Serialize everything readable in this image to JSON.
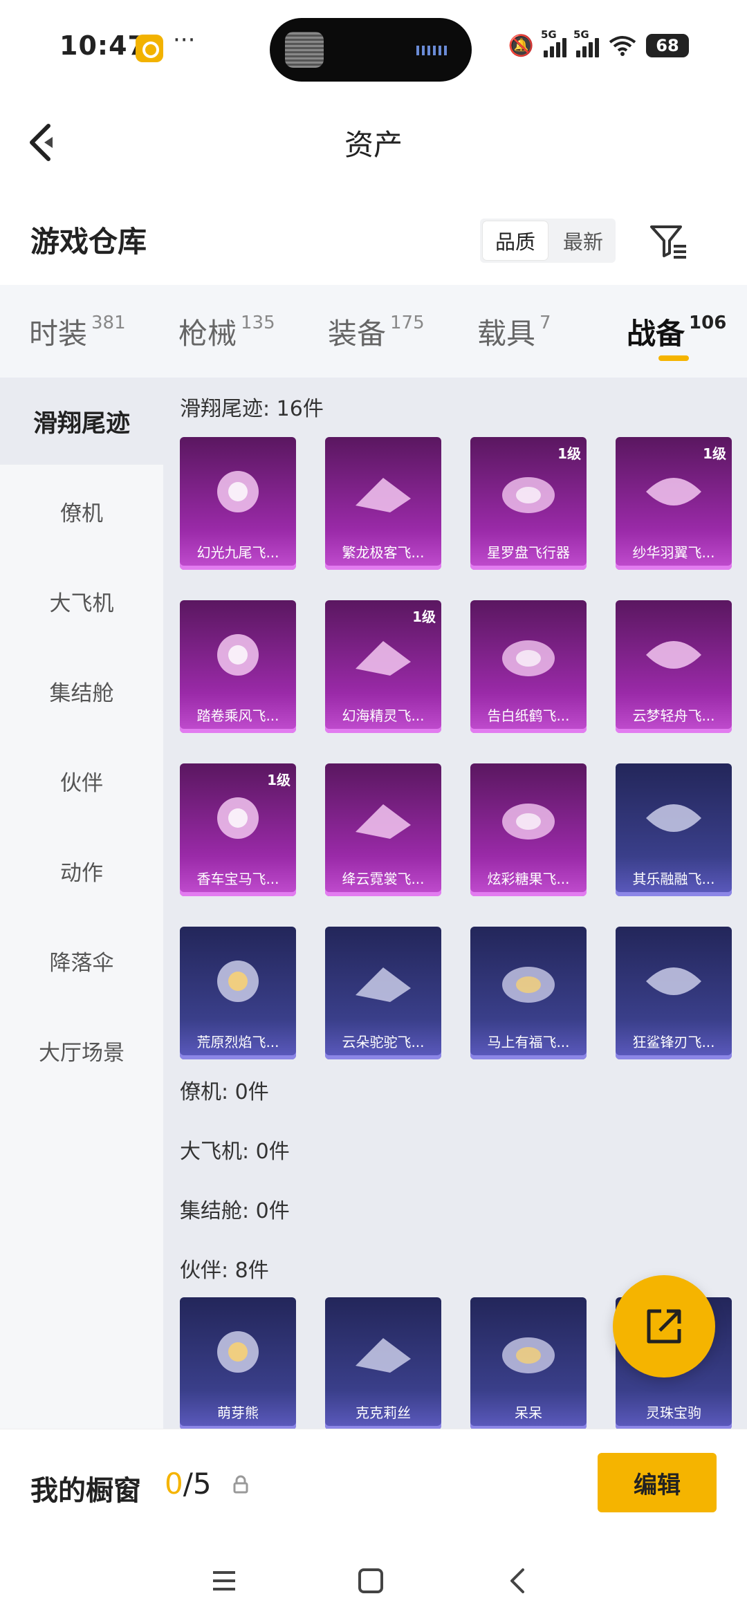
{
  "status_bar": {
    "time": "10:47",
    "more": "···",
    "sig1_label": "5G",
    "sig2_label": "5G",
    "battery": "68"
  },
  "header": {
    "title": "资产"
  },
  "warehouse": {
    "title": "游戏仓库",
    "sort_options": [
      "品质",
      "最新"
    ]
  },
  "tabs": [
    {
      "label": "时装",
      "count": "381"
    },
    {
      "label": "枪械",
      "count": "135"
    },
    {
      "label": "装备",
      "count": "175"
    },
    {
      "label": "载具",
      "count": "7"
    },
    {
      "label": "战备",
      "count": "106"
    }
  ],
  "sidebar": {
    "items": [
      "滑翔尾迹",
      "僚机",
      "大飞机",
      "集结舱",
      "伙伴",
      "动作",
      "降落伞",
      "大厅场景"
    ]
  },
  "sections": {
    "glide": {
      "title": "滑翔尾迹: 16件"
    },
    "wingman": {
      "title": "僚机: 0件"
    },
    "bigplane": {
      "title": "大飞机: 0件"
    },
    "capsule": {
      "title": "集结舱: 0件"
    },
    "partner": {
      "title": "伙伴: 8件"
    }
  },
  "glide_items": [
    {
      "name": "幻光九尾飞...",
      "level": "",
      "rarity": "purple"
    },
    {
      "name": "繁龙极客飞...",
      "level": "",
      "rarity": "purple"
    },
    {
      "name": "星罗盘飞行器",
      "level": "1级",
      "rarity": "purple"
    },
    {
      "name": "纱华羽翼飞...",
      "level": "1级",
      "rarity": "purple"
    },
    {
      "name": "踏卷乘风飞...",
      "level": "",
      "rarity": "purple"
    },
    {
      "name": "幻海精灵飞...",
      "level": "1级",
      "rarity": "purple"
    },
    {
      "name": "告白纸鹤飞...",
      "level": "",
      "rarity": "purple"
    },
    {
      "name": "云梦轻舟飞...",
      "level": "",
      "rarity": "purple"
    },
    {
      "name": "香车宝马飞...",
      "level": "1级",
      "rarity": "purple"
    },
    {
      "name": "绛云霓裳飞...",
      "level": "",
      "rarity": "purple"
    },
    {
      "name": "炫彩糖果飞...",
      "level": "",
      "rarity": "purple"
    },
    {
      "name": "其乐融融飞...",
      "level": "",
      "rarity": "blue"
    },
    {
      "name": "荒原烈焰飞...",
      "level": "",
      "rarity": "blue"
    },
    {
      "name": "云朵驼驼飞...",
      "level": "",
      "rarity": "blue"
    },
    {
      "name": "马上有福飞...",
      "level": "",
      "rarity": "blue"
    },
    {
      "name": "狂鲨锋刃飞...",
      "level": "",
      "rarity": "blue"
    }
  ],
  "partner_items": [
    {
      "name": "萌芽熊",
      "level": "",
      "rarity": "blue"
    },
    {
      "name": "克克莉丝",
      "level": "",
      "rarity": "blue"
    },
    {
      "name": "呆呆",
      "level": "",
      "rarity": "blue"
    },
    {
      "name": "灵珠宝驹",
      "level": "",
      "rarity": "blue"
    }
  ],
  "showcase": {
    "label": "我的橱窗",
    "filled": "0",
    "total": "/5",
    "edit_label": "编辑"
  },
  "colors": {
    "accent": "#f5b400",
    "purple_card": "#9a2aa8",
    "blue_card": "#3a3f8a"
  }
}
